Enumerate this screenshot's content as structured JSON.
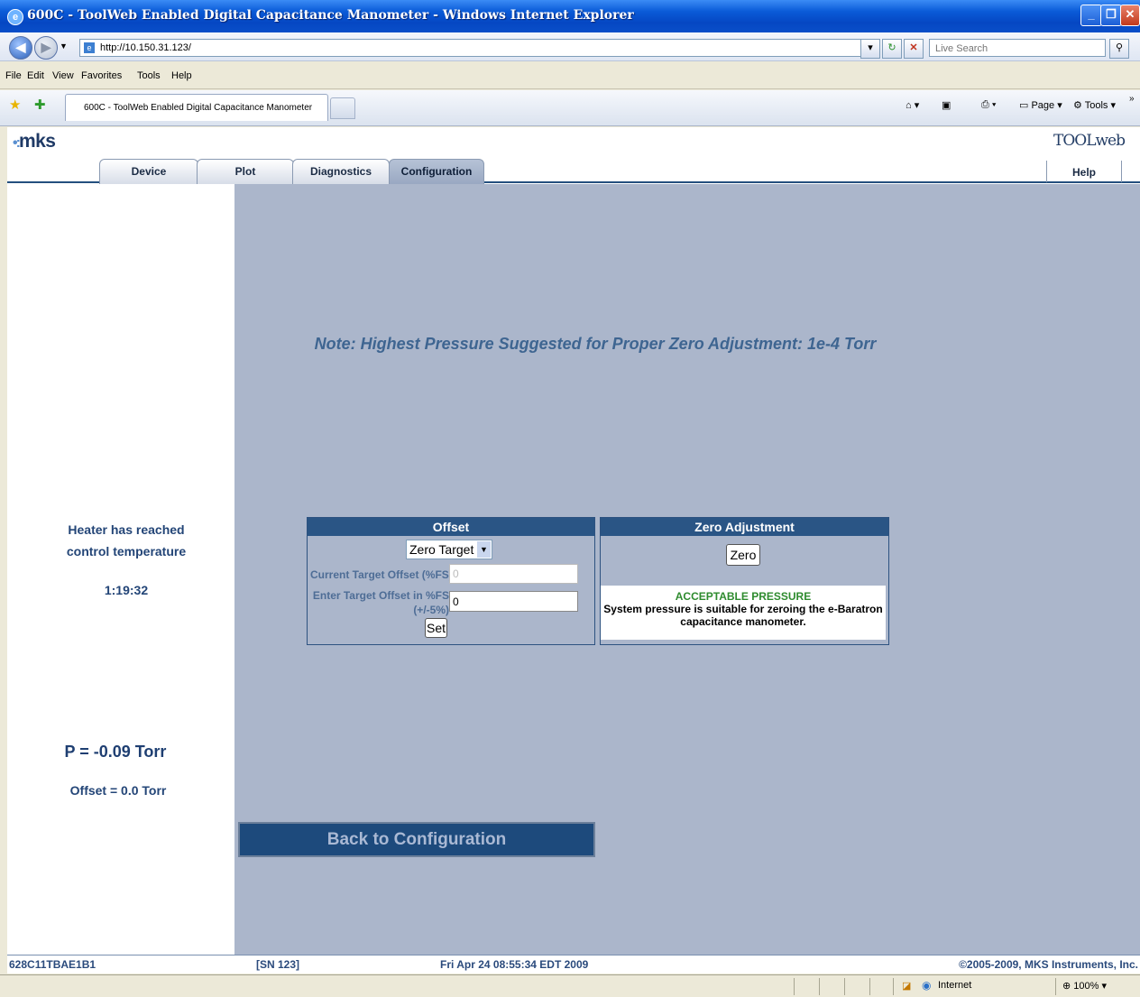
{
  "window": {
    "title": "600C - ToolWeb Enabled Digital Capacitance Manometer - Windows Internet Explorer",
    "icon": "ie-icon"
  },
  "address_bar": {
    "url": "http://10.150.31.123/",
    "search_placeholder": "Live Search"
  },
  "menu": [
    "File",
    "Edit",
    "View",
    "Favorites",
    "Tools",
    "Help"
  ],
  "browser_tab": {
    "label": "600C - ToolWeb Enabled Digital Capacitance Manometer"
  },
  "command_bar": {
    "page_label": "Page",
    "tools_label": "Tools"
  },
  "app": {
    "logo": "mks",
    "brand": "TOOLweb",
    "tabs": [
      "Device",
      "Plot",
      "Diagnostics",
      "Configuration"
    ],
    "selected_tab": "Configuration",
    "help_label": "Help"
  },
  "sidebar": {
    "heater_line1": "Heater has reached",
    "heater_line2": "control temperature",
    "time": "1:19:32",
    "pressure": "P = -0.09 Torr",
    "offset": "Offset = 0.0 Torr"
  },
  "main": {
    "note": "Note: Highest Pressure Suggested for Proper Zero Adjustment: 1e-4 Torr",
    "offset_panel": {
      "title": "Offset",
      "select_value": "Zero Target",
      "current_label": "Current Target Offset (%FS)",
      "current_value": "0",
      "enter_label_line1": "Enter Target Offset in %FS",
      "enter_label_line2": "(+/-5%)",
      "enter_value": "0",
      "set_label": "Set"
    },
    "zero_panel": {
      "title": "Zero Adjustment",
      "zero_label": "Zero",
      "status_title": "ACCEPTABLE PRESSURE",
      "status_text_line1": "System pressure is suitable for zeroing the e-Baratron",
      "status_text_line2": "capacitance manometer."
    },
    "back_label": "Back to Configuration"
  },
  "footer": {
    "model": "628C11TBAE1B1",
    "serial": "[SN 123]",
    "datetime": "Fri Apr 24 08:55:34 EDT 2009",
    "copyright": "©2005-2009, MKS Instruments, Inc."
  },
  "status_bar": {
    "zone": "Internet",
    "zoom": "100%"
  },
  "colors": {
    "main_bg": "#abb6cb",
    "accent": "#2a5585",
    "acceptable": "#2e8b2e"
  }
}
